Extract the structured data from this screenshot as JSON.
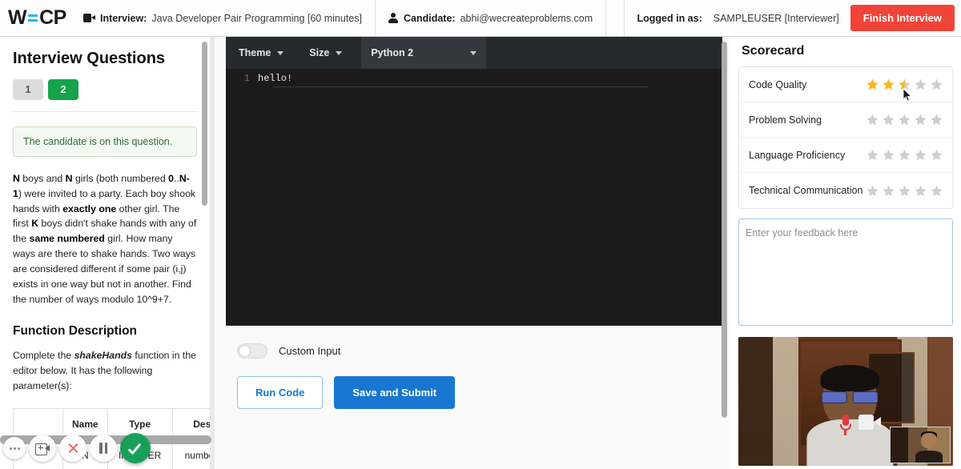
{
  "header": {
    "logo_text": "WECP",
    "interview_label": "Interview:",
    "interview_value": "Java Developer Pair Programming [60 minutes]",
    "candidate_label": "Candidate:",
    "candidate_value": "abhi@wecreateproblems.com",
    "logged_in_label": "Logged in as:",
    "logged_in_value": "SAMPLEUSER [Interviewer]",
    "finish_button": "Finish Interview"
  },
  "left_panel": {
    "title": "Interview Questions",
    "tabs": [
      {
        "label": "1",
        "active": false
      },
      {
        "label": "2",
        "active": true
      }
    ],
    "notice": "The candidate is on this question.",
    "question_html": "<b>N</b> boys and <b>N</b> girls (both numbered <b>0</b>..<b>N-1</b>) were invited to a party. Each boy shook hands with <b>exactly one</b> other girl. The first <b>K</b> boys didn't shake hands with any of the <b>same numbered</b> girl. How many ways are there to shake hands. Two ways are considered different if some pair (i,j) exists in one way but not in another. Find the number of ways modulo 10^9+7.",
    "function_section_title": "Function Description",
    "function_desc_html": "Complete the <i>shakeHands</i> function in the editor below. It has the following parameter(s):",
    "param_table": {
      "headers": [
        "",
        "Name",
        "Type",
        "Descript"
      ],
      "rows": [
        [
          "",
          "N",
          "INTEGER",
          "number boys"
        ]
      ]
    }
  },
  "editor": {
    "theme_label": "Theme",
    "size_label": "Size",
    "language_value": "Python 2",
    "lines": [
      {
        "number": "1",
        "text": "hello!"
      }
    ],
    "custom_input_label": "Custom Input",
    "custom_input_on": false,
    "run_button": "Run Code",
    "submit_button": "Save and Submit"
  },
  "scorecard": {
    "title": "Scorecard",
    "max_stars": 5,
    "rows": [
      {
        "name": "Code Quality",
        "rating": 2.5
      },
      {
        "name": "Problem Solving",
        "rating": 0
      },
      {
        "name": "Language Proficiency",
        "rating": 0
      },
      {
        "name": "Technical Communication",
        "rating": 0
      }
    ],
    "feedback_placeholder": "Enter your feedback here",
    "feedback_value": ""
  },
  "colors": {
    "brand_blue": "#29b6e8",
    "finish_red": "#f04438",
    "active_tab_green": "#16a34a",
    "primary_blue": "#1877d2",
    "star_gold": "#f9b917",
    "star_gray": "#cfcfcf",
    "accept_green": "#18a05a"
  },
  "call_controls": [
    {
      "icon": "more-options-icon",
      "label": "More options"
    },
    {
      "icon": "add-camera-icon",
      "label": "Add camera"
    },
    {
      "icon": "end-call-icon",
      "label": "End call"
    },
    {
      "icon": "pause-icon",
      "label": "Pause"
    },
    {
      "icon": "accept-check-icon",
      "label": "Accept"
    }
  ]
}
